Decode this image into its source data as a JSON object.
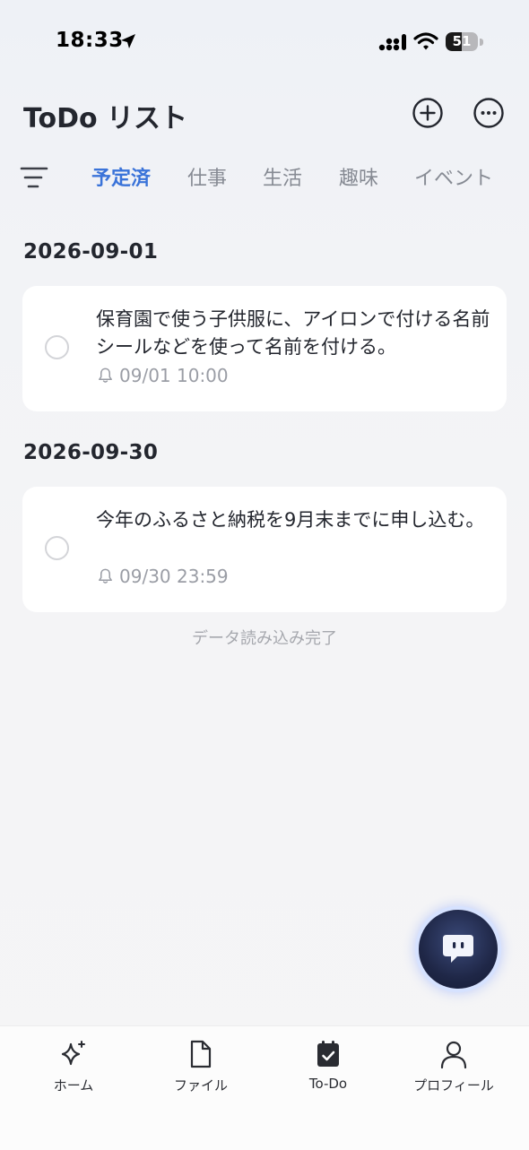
{
  "status_bar": {
    "time": "18:33",
    "battery": "51",
    "battery_level": 0.51
  },
  "header": {
    "title": "ToDo リスト",
    "add_icon": "plus-circle-icon",
    "more_icon": "ellipsis-circle-icon"
  },
  "tabs": [
    {
      "label": "予定済",
      "active": true
    },
    {
      "label": "仕事"
    },
    {
      "label": "生活"
    },
    {
      "label": "趣味"
    },
    {
      "label": "イベント"
    }
  ],
  "groups": [
    {
      "date": "2026-09-01",
      "tasks": [
        {
          "text": "保育園で使う子供服に、アイロンで付ける名前シールなどを使って名前を付ける。",
          "reminder": "09/01 10:00"
        }
      ]
    },
    {
      "date": "2026-09-30",
      "tasks": [
        {
          "text": "今年のふるさと納税を9月末までに申し込む。",
          "reminder": "09/30 23:59"
        }
      ]
    }
  ],
  "load_status": "データ読み込み完了",
  "fab": {
    "icon": "chat-bubble-icon"
  },
  "bottom_nav": [
    {
      "label": "ホーム",
      "icon": "sparkle-icon"
    },
    {
      "label": "ファイル",
      "icon": "file-icon"
    },
    {
      "label": "To-Do",
      "icon": "calendar-check-icon",
      "active": true
    },
    {
      "label": "プロフィール",
      "icon": "person-icon"
    }
  ],
  "colors": {
    "accent": "#3a73d9",
    "text": "#23262e",
    "muted": "#9a9da5"
  }
}
